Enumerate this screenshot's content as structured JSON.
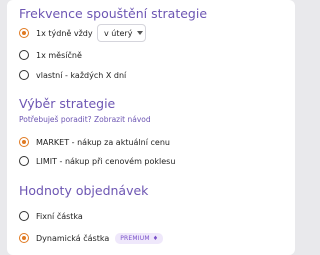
{
  "sections": {
    "frequency": {
      "title": "Frekvence spouštění strategie",
      "options": [
        {
          "label": "1x týdně vždy",
          "checked": true
        },
        {
          "label": "1x měsíčně",
          "checked": false
        },
        {
          "label": "vlastní - každých X dní",
          "checked": false
        }
      ],
      "weekday_select": {
        "value": "v úterý"
      }
    },
    "strategy": {
      "title": "Výběr strategie",
      "help_link": "Potřebuješ poradit? Zobrazit návod",
      "options": [
        {
          "label": "MARKET - nákup za aktuální cenu",
          "checked": true
        },
        {
          "label": "LIMIT - nákup při cenovém poklesu",
          "checked": false
        }
      ]
    },
    "order_values": {
      "title": "Hodnoty objednávek",
      "options": [
        {
          "label": "Fixní částka",
          "checked": false
        },
        {
          "label": "Dynamická částka",
          "checked": true,
          "badge": "PREMIUM"
        }
      ]
    }
  },
  "colors": {
    "accent_purple": "#6d56b3",
    "radio_selected": "#e07a22",
    "badge_bg": "#efe8fb"
  },
  "icons": {
    "premium_badge_icon": "gem-icon",
    "select_icon": "chevron-down-icon"
  }
}
